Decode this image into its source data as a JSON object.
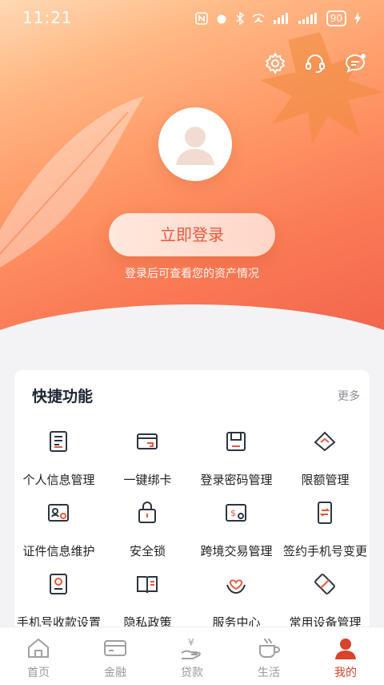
{
  "status_bar": {
    "time": "11:21",
    "battery": "90"
  },
  "header": {
    "login_button": "立即登录",
    "login_tip": "登录后可查看您的资产情况"
  },
  "quick": {
    "title": "快捷功能",
    "more": "更多",
    "items": [
      {
        "label": "个人信息管理",
        "icon": "profile-doc-icon"
      },
      {
        "label": "一键绑卡",
        "icon": "card-bind-icon"
      },
      {
        "label": "登录密码管理",
        "icon": "password-icon"
      },
      {
        "label": "限额管理",
        "icon": "limit-icon"
      },
      {
        "label": "证件信息维护",
        "icon": "id-card-icon"
      },
      {
        "label": "安全锁",
        "icon": "lock-icon"
      },
      {
        "label": "跨境交易管理",
        "icon": "cross-border-icon"
      },
      {
        "label": "签约手机号变更",
        "icon": "phone-change-icon"
      },
      {
        "label": "手机号收款设置",
        "icon": "phone-receive-icon"
      },
      {
        "label": "隐私政策",
        "icon": "privacy-book-icon"
      },
      {
        "label": "服务中心",
        "icon": "service-heart-icon"
      },
      {
        "label": "常用设备管理",
        "icon": "device-icon"
      }
    ]
  },
  "tabs": [
    {
      "label": "首页",
      "icon": "home-icon",
      "active": false
    },
    {
      "label": "金融",
      "icon": "finance-card-icon",
      "active": false
    },
    {
      "label": "贷款",
      "icon": "loan-hand-icon",
      "active": false
    },
    {
      "label": "生活",
      "icon": "coffee-cup-icon",
      "active": false
    },
    {
      "label": "我的",
      "icon": "user-icon",
      "active": true
    }
  ],
  "colors": {
    "accent": "#d8432a",
    "icon_stroke": "#2d3440"
  }
}
